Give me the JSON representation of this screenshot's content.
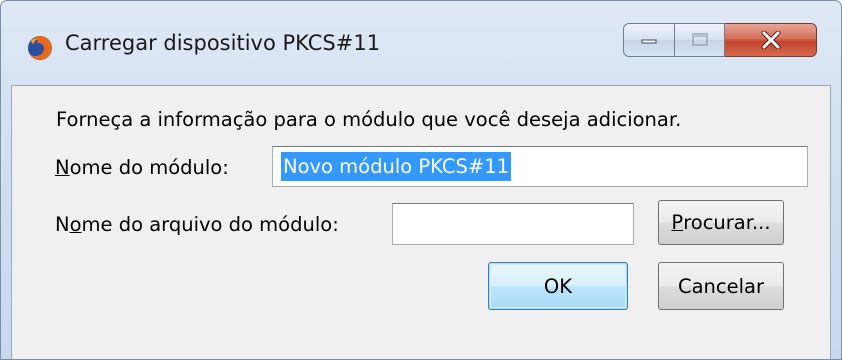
{
  "window": {
    "title": "Carregar dispositivo PKCS#11",
    "app_icon": "firefox-icon",
    "caption_buttons": [
      "minimize-icon",
      "maximize-icon",
      "close-icon"
    ],
    "close_color": "#c2442a"
  },
  "dialog": {
    "intro": "Forneça a informação para o módulo que você deseja adicionar.",
    "module_name": {
      "label_accel": "N",
      "label_rest": "ome do módulo:",
      "value": "Novo módulo PKCS#11",
      "selected": true
    },
    "module_file": {
      "label_pre": "N",
      "label_accel": "o",
      "label_rest": "me do arquivo do módulo:",
      "value": ""
    },
    "browse_button": {
      "accel": "P",
      "rest": "rocurar..."
    },
    "ok_button": "OK",
    "cancel_button": "Cancelar"
  },
  "colors": {
    "selection": "#3399ff",
    "dialog_bg": "#f0f0f0",
    "default_button_border": "#3c7fb1"
  }
}
